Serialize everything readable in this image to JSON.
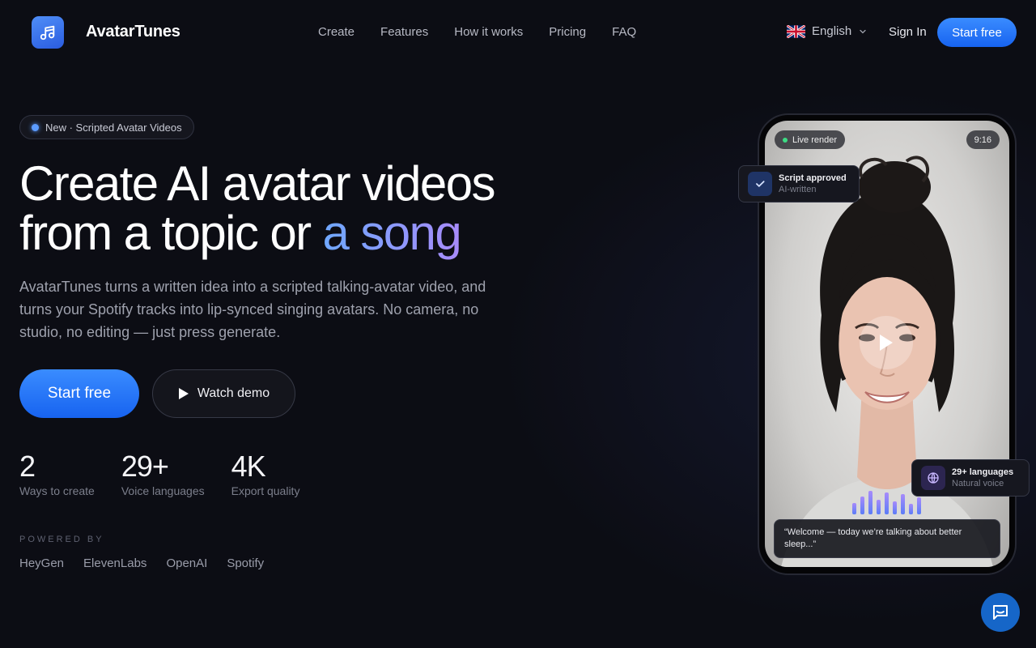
{
  "brand": {
    "name": "AvatarTunes",
    "logo_icon": "music-note-icon"
  },
  "nav": {
    "items": [
      "Create",
      "Features",
      "How it works",
      "Pricing",
      "FAQ"
    ]
  },
  "header": {
    "language": "English",
    "language_flag": "uk-flag-icon",
    "signin": "Sign In",
    "start": "Start free"
  },
  "hero": {
    "badge": "New · Scripted Avatar Videos",
    "title_line1": "Create AI avatar videos",
    "title_line2_plain": "from a topic or ",
    "title_line2_accent": "a song",
    "lead": "AvatarTunes turns a written idea into a scripted talking-avatar video, and turns your Spotify tracks into lip-synced singing avatars. No camera, no studio, no editing — just press generate.",
    "cta_primary": "Start free",
    "cta_secondary": "Watch demo"
  },
  "stats": [
    {
      "value": "2",
      "label": "Ways to create"
    },
    {
      "value": "29+",
      "label": "Voice languages"
    },
    {
      "value": "4K",
      "label": "Export quality"
    }
  ],
  "powered": {
    "label": "POWERED BY",
    "partners": [
      "HeyGen",
      "ElevenLabs",
      "OpenAI",
      "Spotify"
    ]
  },
  "preview": {
    "live": "Live render",
    "ratio": "9:16",
    "caption": "“Welcome — today we’re talking about better sleep...”",
    "card_script": {
      "title": "Script approved",
      "sub": "AI-written"
    },
    "card_lang": {
      "title": "29+ languages",
      "sub": "Natural voice"
    }
  },
  "colors": {
    "accent": "#1f74ff",
    "background": "#0c0d14",
    "gradient_end": "#a78bfa"
  }
}
